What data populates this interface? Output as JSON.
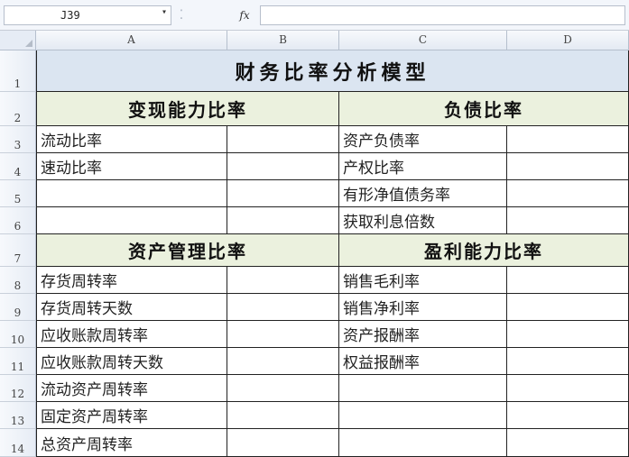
{
  "formula_bar": {
    "name_box": "J39",
    "name_box_arrow": "▾",
    "separator": "⁚",
    "fx_label": "fx",
    "formula": ""
  },
  "columns": [
    "A",
    "B",
    "C",
    "D"
  ],
  "rows": [
    "1",
    "2",
    "3",
    "4",
    "5",
    "6",
    "7",
    "8",
    "9",
    "10",
    "11",
    "12",
    "13",
    "14"
  ],
  "sheet": {
    "title": "财务比率分析模型",
    "sections": {
      "liquidity": "变现能力比率",
      "debt": "负债比率",
      "asset_mgmt": "资产管理比率",
      "profit": "盈利能力比率"
    },
    "liquidity_items": [
      "流动比率",
      "速动比率"
    ],
    "debt_items": [
      "资产负债率",
      "产权比率",
      "有形净值债务率",
      "获取利息倍数"
    ],
    "asset_mgmt_items": [
      "存货周转率",
      "存货周转天数",
      "应收账款周转率",
      "应收账款周转天数",
      "流动资产周转率",
      "固定资产周转率",
      "总资产周转率"
    ],
    "profit_items": [
      "销售毛利率",
      "销售净利率",
      "资产报酬率",
      "权益报酬率"
    ]
  },
  "colors": {
    "title_fill": "#dbe5f1",
    "section_fill": "#ebf1de",
    "border": "#222222"
  }
}
